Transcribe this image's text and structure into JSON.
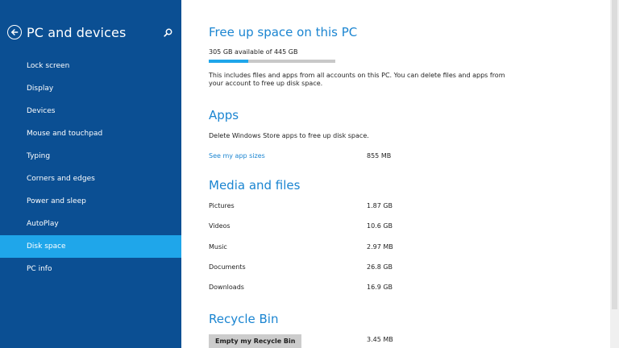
{
  "sidebar": {
    "title": "PC and devices",
    "items": [
      {
        "label": "Lock screen",
        "active": false
      },
      {
        "label": "Display",
        "active": false
      },
      {
        "label": "Devices",
        "active": false
      },
      {
        "label": "Mouse and touchpad",
        "active": false
      },
      {
        "label": "Typing",
        "active": false
      },
      {
        "label": "Corners and edges",
        "active": false
      },
      {
        "label": "Power and sleep",
        "active": false
      },
      {
        "label": "AutoPlay",
        "active": false
      },
      {
        "label": "Disk space",
        "active": true
      },
      {
        "label": "PC info",
        "active": false
      }
    ]
  },
  "main": {
    "free_space": {
      "title": "Free up space on this PC",
      "storage_text": "305 GB available of 445 GB",
      "used_fraction": 0.315,
      "description_line1": "This includes files and apps from all accounts on this PC. You can delete files and apps from",
      "description_line2": "your account to free up disk space."
    },
    "apps": {
      "title": "Apps",
      "description": "Delete Windows Store apps to free up disk space.",
      "link_label": "See my app sizes",
      "size": "855 MB"
    },
    "media": {
      "title": "Media and files",
      "rows": [
        {
          "label": "Pictures",
          "size": "1.87 GB"
        },
        {
          "label": "Videos",
          "size": "10.6 GB"
        },
        {
          "label": "Music",
          "size": "2.97 MB"
        },
        {
          "label": "Documents",
          "size": "26.8 GB"
        },
        {
          "label": "Downloads",
          "size": "16.9 GB"
        }
      ]
    },
    "recycle": {
      "title": "Recycle Bin",
      "button_label": "Empty my Recycle Bin",
      "size": "3.45 MB"
    }
  },
  "colors": {
    "sidebar_bg": "#0b4f93",
    "accent": "#1fa6ea",
    "heading": "#1b85d1"
  },
  "icons": {
    "back": "back-arrow-icon",
    "search": "search-icon"
  }
}
